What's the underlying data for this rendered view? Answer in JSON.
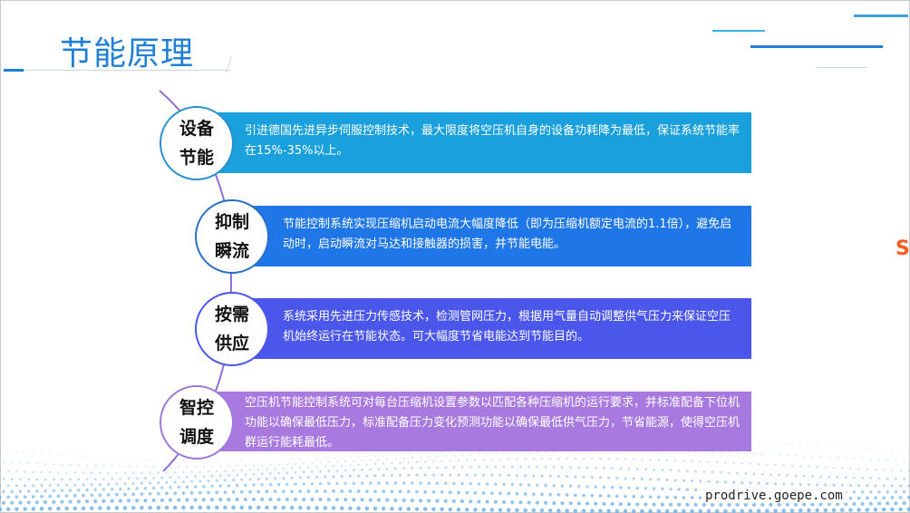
{
  "title": "节能原理",
  "footer": "prodrive.goepe.com",
  "items": [
    {
      "head1": "设备",
      "head2": "节能",
      "text": "引进德国先进异步伺服控制技术，最大限度将空压机自身的设备功耗降为最低，保证系统节能率在15%-35%以上。"
    },
    {
      "head1": "抑制",
      "head2": "瞬流",
      "text": "节能控制系统实现压缩机启动电流大幅度降低（即为压缩机额定电流的1.1倍），避免启动时，启动瞬流对马达和接触器的损害，并节能电能。"
    },
    {
      "head1": "按需",
      "head2": "供应",
      "text": "系统采用先进压力传感技术，检测管网压力，根据用气量自动调整供气压力来保证空压机始终运行在节能状态。可大幅度节省电能达到节能目的。"
    },
    {
      "head1": "智控",
      "head2": "调度",
      "text": "空压机节能控制系统可对每台压缩机设置参数以匹配各种压缩机的运行要求，并标准配备下位机功能以确保最低压力，标准配备压力变化预测功能以确保最低供气压力，节省能源，使得空压机群运行能耗最低。"
    }
  ],
  "colors": {
    "title": "#1f7fd6",
    "bar1": "#1aa0dc",
    "bar2": "#1f76e6",
    "bar3": "#4a57ea",
    "bar4": "#a87ae0"
  }
}
